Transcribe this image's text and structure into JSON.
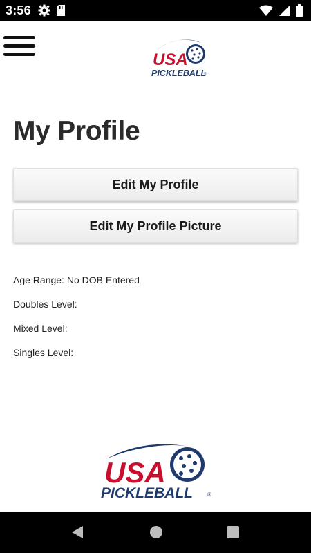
{
  "status_bar": {
    "time": "3:56",
    "icons": [
      "settings-icon",
      "sd-card-icon",
      "wifi-icon",
      "signal-icon",
      "battery-icon"
    ]
  },
  "header": {
    "menu_icon": "hamburger-menu-icon",
    "logo": {
      "line1": "USA",
      "line2": "PICKLEBALL",
      "mark": "®"
    }
  },
  "main": {
    "title": "My Profile",
    "buttons": {
      "edit_profile": "Edit My Profile",
      "edit_picture": "Edit My Profile Picture"
    },
    "info": {
      "age_range": "Age Range: No DOB Entered",
      "doubles_level": "Doubles Level:",
      "mixed_level": "Mixed Level:",
      "singles_level": "Singles Level:"
    }
  },
  "footer": {
    "logo": {
      "line1": "USA",
      "line2": "PICKLEBALL",
      "mark": "®"
    }
  },
  "nav_bar": {
    "icons": [
      "back-icon",
      "home-icon",
      "recents-icon"
    ]
  },
  "colors": {
    "brand_red": "#c8102e",
    "brand_navy": "#1f3a6e",
    "status_bar_bg": "#000000",
    "button_bg": "#f3f3f3"
  }
}
